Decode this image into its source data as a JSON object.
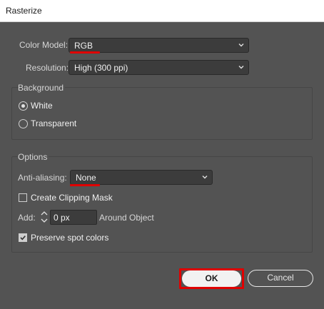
{
  "window": {
    "title": "Rasterize"
  },
  "color_model": {
    "label": "Color Model:",
    "value": "RGB"
  },
  "resolution": {
    "label": "Resolution:",
    "value": "High (300 ppi)"
  },
  "background": {
    "heading": "Background",
    "options": [
      {
        "label": "White",
        "selected": true
      },
      {
        "label": "Transparent",
        "selected": false
      }
    ]
  },
  "options": {
    "heading": "Options",
    "anti_aliasing": {
      "label": "Anti-aliasing:",
      "value": "None"
    },
    "clipping_mask": {
      "label": "Create Clipping Mask",
      "checked": false
    },
    "add": {
      "label": "Add:",
      "value": "0 px",
      "suffix": "Around Object"
    },
    "spot_colors": {
      "label": "Preserve spot colors",
      "checked": true
    }
  },
  "buttons": {
    "ok": "OK",
    "cancel": "Cancel"
  },
  "colors": {
    "dialog_bg": "#535353",
    "field_bg": "#3c3c3c",
    "annotation_red": "#e00000"
  }
}
